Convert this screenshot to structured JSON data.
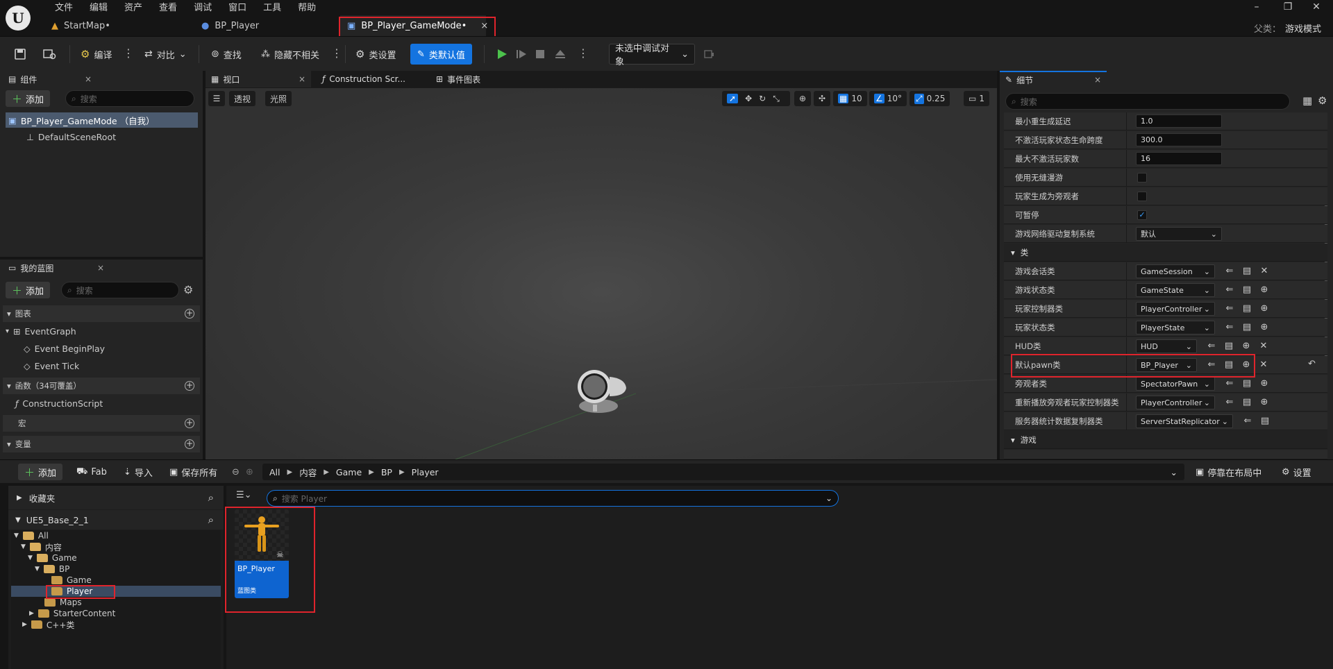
{
  "app": {
    "logo_letter": "U"
  },
  "menu": [
    "文件",
    "编辑",
    "资产",
    "查看",
    "调试",
    "窗口",
    "工具",
    "帮助"
  ],
  "doc_tabs": [
    {
      "label": "StartMap•"
    },
    {
      "label": "BP_Player"
    },
    {
      "label": "BP_Player_GameMode•"
    }
  ],
  "title_right": {
    "parent_label": "父类：",
    "parent_value": "游戏模式"
  },
  "toolbar": {
    "compile": "编译",
    "diff": "对比",
    "find": "查找",
    "hide_unrelated": "隐藏不相关",
    "class_settings": "类设置",
    "class_defaults": "类默认值",
    "debug_object": "未选中调试对象"
  },
  "components_panel": {
    "tab": "组件",
    "add": "添加",
    "search_placeholder": "搜索",
    "root_item": "BP_Player_GameMode （自我）",
    "child_item": "DefaultSceneRoot"
  },
  "my_blueprint": {
    "tab": "我的蓝图",
    "add": "添加",
    "search_placeholder": "搜索",
    "sections": {
      "graphs": "图表",
      "functions": "函数（34可覆盖）",
      "macros": "宏",
      "variables": "变量"
    },
    "event_graph": "EventGraph",
    "events": [
      "Event BeginPlay",
      "Event Tick"
    ],
    "construction_script": "ConstructionScript"
  },
  "editor_tabs": {
    "viewport": "视口",
    "construction": "Construction Scr...",
    "event_graph": "事件图表"
  },
  "viewport": {
    "perspective": "透视",
    "lighting": "光照",
    "grid_snap": "10",
    "rot_snap": "10°",
    "scale_snap": "0.25",
    "camera_speed": "1"
  },
  "details": {
    "tab": "细节",
    "search_placeholder": "搜索",
    "rows_top": [
      {
        "label": "最小重生成延迟",
        "type": "input",
        "value": "1.0"
      },
      {
        "label": "不激活玩家状态生命跨度",
        "type": "input",
        "value": "300.0"
      },
      {
        "label": "最大不激活玩家数",
        "type": "input",
        "value": "16"
      },
      {
        "label": "使用无缝漫游",
        "type": "check",
        "value": ""
      },
      {
        "label": "玩家生成为旁观者",
        "type": "check",
        "value": ""
      },
      {
        "label": "可暂停",
        "type": "check",
        "value": "✓"
      },
      {
        "label": "游戏网络驱动复制系统",
        "type": "select",
        "value": "默认"
      }
    ],
    "section_classes": "类",
    "class_rows": [
      {
        "label": "游戏会话类",
        "value": "GameSession"
      },
      {
        "label": "游戏状态类",
        "value": "GameState"
      },
      {
        "label": "玩家控制器类",
        "value": "PlayerController"
      },
      {
        "label": "玩家状态类",
        "value": "PlayerState"
      },
      {
        "label": "HUD类",
        "value": "HUD"
      },
      {
        "label": "默认pawn类",
        "value": "BP_Player"
      },
      {
        "label": "旁观者类",
        "value": "SpectatorPawn"
      },
      {
        "label": "重新播放旁观者玩家控制器类",
        "value": "PlayerController"
      },
      {
        "label": "服务器统计数据复制器类",
        "value": "ServerStatReplicator"
      }
    ],
    "section_game": "游戏"
  },
  "content_browser": {
    "add": "添加",
    "fab": "Fab",
    "import": "导入",
    "save_all": "保存所有",
    "breadcrumbs": [
      "All",
      "内容",
      "Game",
      "BP",
      "Player"
    ],
    "dock": "停靠在布局中",
    "settings": "设置",
    "favorites": "收藏夹",
    "project": "UE5_Base_2_1",
    "search_placeholder": "搜索 Player",
    "tree": [
      "All",
      "内容",
      "Game",
      "BP",
      "Game",
      "Player",
      "Maps",
      "StarterContent",
      "C++类"
    ],
    "asset": {
      "name": "BP_Player",
      "type": "蓝图类"
    }
  }
}
